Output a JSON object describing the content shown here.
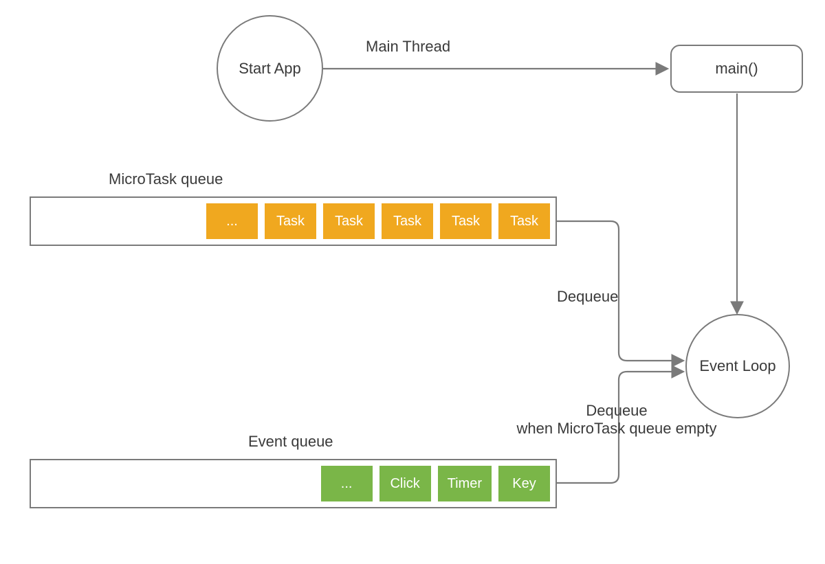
{
  "nodes": {
    "startApp": "Start App",
    "main": "main()",
    "eventLoop": "Event Loop"
  },
  "labels": {
    "mainThread": "Main Thread",
    "microtaskQueue": "MicroTask queue",
    "eventQueue": "Event queue",
    "dequeue": "Dequeue",
    "dequeueWhenEmpty": "Dequeue\nwhen MicroTask queue empty"
  },
  "queues": {
    "microtask": [
      {
        "label": "...",
        "color": "orange"
      },
      {
        "label": "Task",
        "color": "orange"
      },
      {
        "label": "Task",
        "color": "orange"
      },
      {
        "label": "Task",
        "color": "orange"
      },
      {
        "label": "Task",
        "color": "orange"
      },
      {
        "label": "Task",
        "color": "orange"
      }
    ],
    "event": [
      {
        "label": "...",
        "color": "green"
      },
      {
        "label": "Click",
        "color": "green"
      },
      {
        "label": "Timer",
        "color": "green"
      },
      {
        "label": "Key",
        "color": "green"
      }
    ]
  },
  "colors": {
    "stroke": "#7a7a7a",
    "orange": "#f0a81f",
    "green": "#7ab648"
  }
}
